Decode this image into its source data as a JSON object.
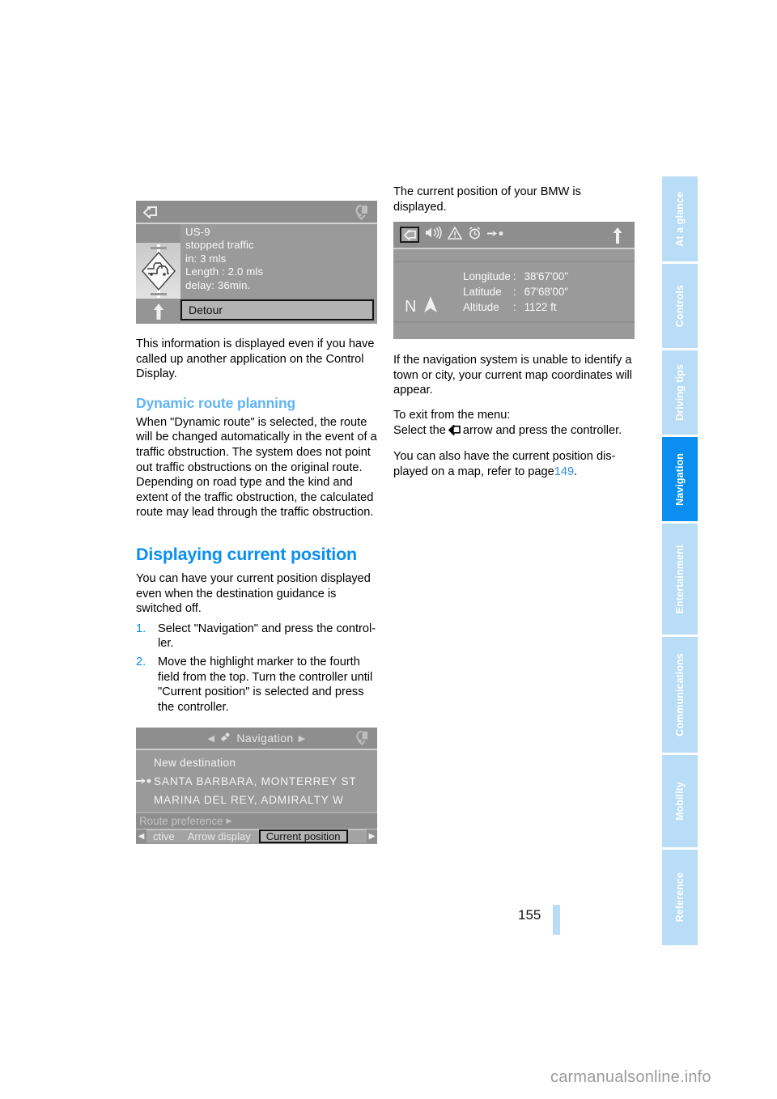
{
  "document": {
    "page_number": "155",
    "watermark": "carmanualsonline.info"
  },
  "sidebar": {
    "tabs": [
      {
        "label": "At a glance",
        "active": false
      },
      {
        "label": "Controls",
        "active": false
      },
      {
        "label": "Driving tips",
        "active": false
      },
      {
        "label": "Navigation",
        "active": true
      },
      {
        "label": "Entertainment",
        "active": false
      },
      {
        "label": "Communications",
        "active": false
      },
      {
        "label": "Mobility",
        "active": false
      },
      {
        "label": "Reference",
        "active": false
      }
    ],
    "active_color": "#0a8ff0",
    "inactive_color": "#b9dcf7"
  },
  "left_column": {
    "traffic_screenshot": {
      "road": "US-9",
      "condition": "stopped traffic",
      "distance": "in: 3 mls",
      "length": "Length :  2.0 mls",
      "delay": "delay: 36min.",
      "detour_button": "Detour"
    },
    "para1": "This information is displayed even if you have called up another application on the Control Display.",
    "heading_dynamic": "Dynamic route planning",
    "para2": "When \"Dynamic route\" is selected, the route will be changed automatically in the event of a traffic obstruction. The system does not point out traffic obstructions on the original route. Depending on road type and the kind and extent of the traffic obstruction, the calculated route may lead through the traffic obstruction.",
    "heading_display": "Displaying current position",
    "para3": "You can have your current position displayed even when the destination guidance is switched off.",
    "steps": [
      {
        "num": "1.",
        "text": "Select \"Navigation\" and press the control-ler."
      },
      {
        "num": "2.",
        "text": "Move the highlight marker to the fourth field from the top. Turn the controller until \"Current position\" is selected and press the controller."
      }
    ],
    "nav_screenshot": {
      "title": "Navigation",
      "item_new_destination": "New destination",
      "item_dest_line1": "SANTA BARBARA, MONTERREY ST",
      "item_dest_line2": "MARINA DEL REY, ADMIRALTY W",
      "route_preference": "Route preference",
      "bottom_item1": "ctive",
      "bottom_item2": "Arrow display",
      "bottom_selected": "Current position"
    }
  },
  "right_column": {
    "intro": "The current position of your BMW is displayed.",
    "coords_screenshot": {
      "compass_letter": "N",
      "rows": [
        {
          "label": "Longitude",
          "colon": ":",
          "value": "38′67'00\""
        },
        {
          "label": "Latitude",
          "colon": ":",
          "value": "67′68'00\""
        },
        {
          "label": "Altitude",
          "colon": ":",
          "value": "1122 ft"
        }
      ]
    },
    "para1": "If the navigation system is unable to identify a town or city, your current map coordinates will appear.",
    "para2_line1": "To exit from the menu:",
    "para2_prefix": "Select the",
    "para2_suffix": "arrow and press the controller.",
    "para3_prefix": "You can also have the current position dis-played on a map, refer to page",
    "para3_link": "149",
    "para3_suffix": "."
  }
}
